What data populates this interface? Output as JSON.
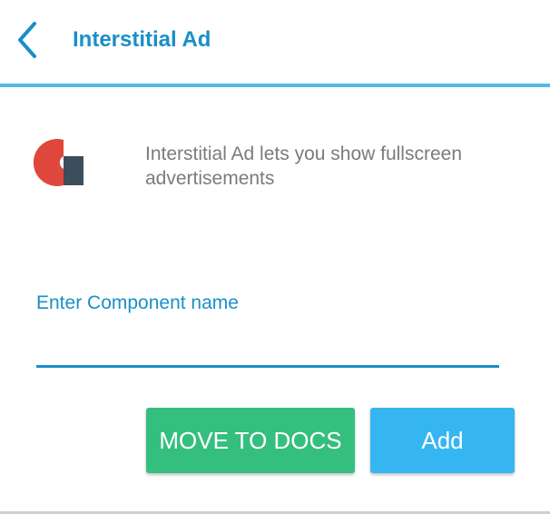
{
  "header": {
    "title": "Interstitial Ad",
    "back_icon": "chevron-left-icon"
  },
  "intro": {
    "logo_icon": "component-logo-icon",
    "description": "Interstitial Ad lets you show fullscreen advertisements"
  },
  "form": {
    "label": "Enter Component name",
    "value": "",
    "placeholder": ""
  },
  "actions": {
    "move_to_docs_label": "MOVE TO DOCS",
    "add_label": "Add"
  },
  "colors": {
    "accent": "#1a8fc9",
    "divider": "#57b8dd",
    "docs_button": "#35bf7e",
    "add_button": "#36b6f1",
    "logo_red": "#e0473c",
    "logo_slate": "#3c4e5c"
  }
}
